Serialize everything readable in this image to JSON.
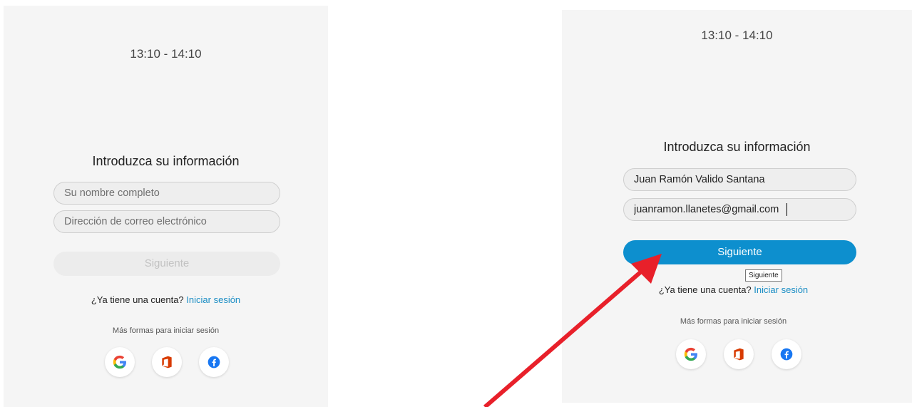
{
  "left_form": {
    "time": "13:10 - 14:10",
    "heading": "Introduzca su información",
    "name_placeholder": "Su nombre completo",
    "email_placeholder": "Dirección de correo electrónico",
    "next_label": "Siguiente",
    "account_question": "¿Ya tiene una cuenta?",
    "signin_link": "Iniciar sesión",
    "more_ways": "Más formas para iniciar sesión"
  },
  "right_form": {
    "time": "13:10 - 14:10",
    "heading": "Introduzca su información",
    "name_value": "Juan Ramón Valido Santana",
    "email_value": "juanramon.llanetes@gmail.com",
    "next_label": "Siguiente",
    "tooltip": "Siguiente",
    "account_question": "¿Ya tiene una cuenta?",
    "signin_link": "Iniciar sesión",
    "more_ways": "Más formas para iniciar sesión"
  },
  "social_icons": [
    "google-icon",
    "office-icon",
    "facebook-icon"
  ],
  "colors": {
    "accent": "#0d8fce",
    "link": "#1a8dc4",
    "arrow": "#e8202a",
    "panel_bg": "#f5f5f5"
  }
}
